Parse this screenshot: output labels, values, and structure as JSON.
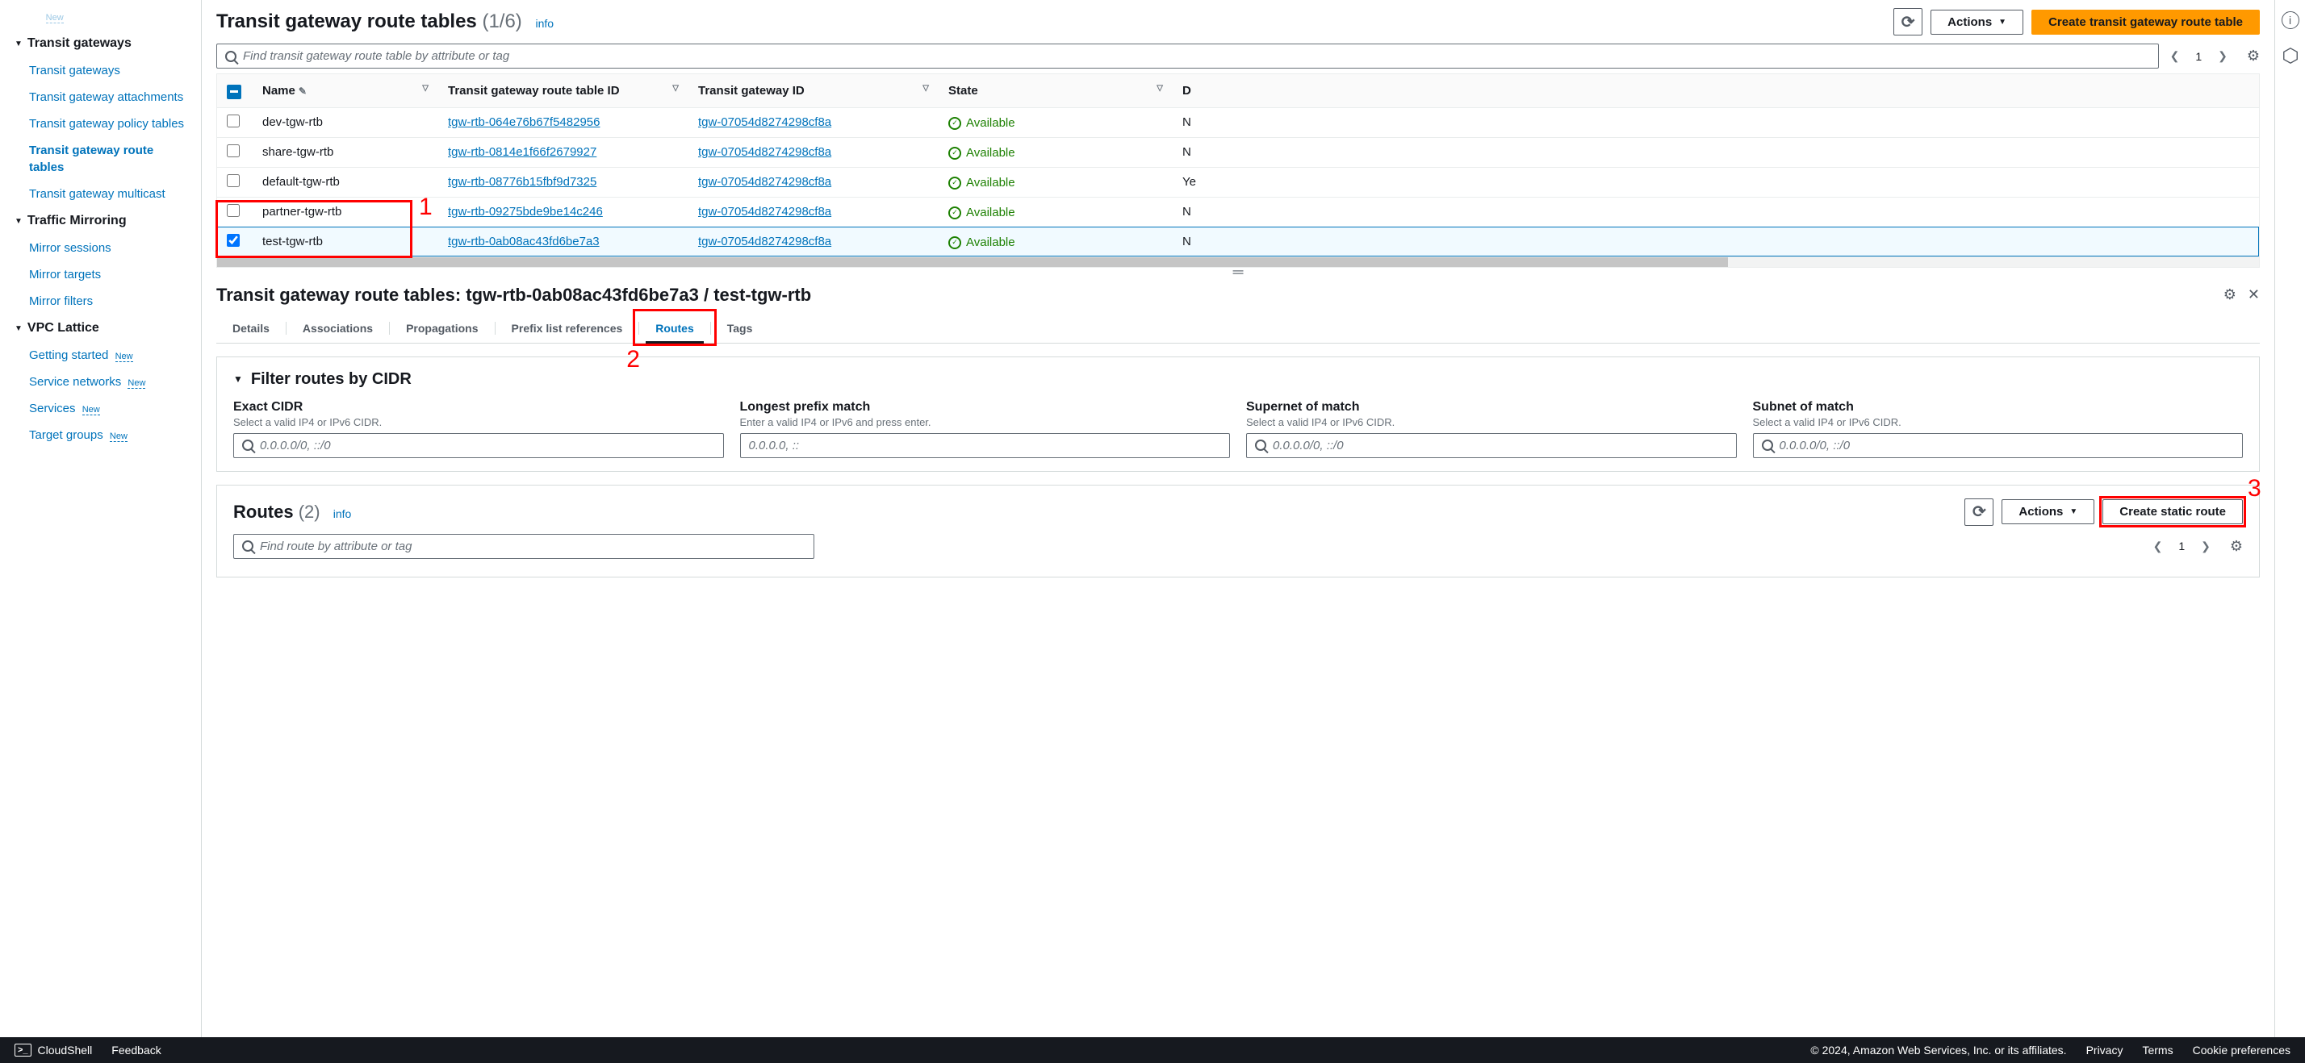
{
  "sidebar": {
    "truncated_top": {
      "label": "",
      "new": "New"
    },
    "sections": [
      {
        "title": "Transit gateways",
        "items": [
          {
            "label": "Transit gateways"
          },
          {
            "label": "Transit gateway attachments"
          },
          {
            "label": "Transit gateway policy tables"
          },
          {
            "label": "Transit gateway route tables",
            "active": true
          },
          {
            "label": "Transit gateway multicast"
          }
        ]
      },
      {
        "title": "Traffic Mirroring",
        "items": [
          {
            "label": "Mirror sessions"
          },
          {
            "label": "Mirror targets"
          },
          {
            "label": "Mirror filters"
          }
        ]
      },
      {
        "title": "VPC Lattice",
        "items": [
          {
            "label": "Getting started",
            "new": "New"
          },
          {
            "label": "Service networks",
            "new": "New"
          },
          {
            "label": "Services",
            "new": "New"
          },
          {
            "label": "Target groups",
            "new": "New"
          }
        ]
      }
    ]
  },
  "header": {
    "title": "Transit gateway route tables",
    "count": "(1/6)",
    "info": "info",
    "actions_label": "Actions",
    "create_label": "Create transit gateway route table",
    "search_placeholder": "Find transit gateway route table by attribute or tag",
    "page": "1"
  },
  "table": {
    "cols": {
      "name": "Name",
      "rtid": "Transit gateway route table ID",
      "tgwid": "Transit gateway ID",
      "state": "State",
      "d": "D"
    },
    "rows": [
      {
        "name": "dev-tgw-rtb",
        "rtid": "tgw-rtb-064e76b67f5482956",
        "tgwid": "tgw-07054d8274298cf8a",
        "state": "Available",
        "d": "N",
        "checked": false
      },
      {
        "name": "share-tgw-rtb",
        "rtid": "tgw-rtb-0814e1f66f2679927",
        "tgwid": "tgw-07054d8274298cf8a",
        "state": "Available",
        "d": "N",
        "checked": false
      },
      {
        "name": "default-tgw-rtb",
        "rtid": "tgw-rtb-08776b15fbf9d7325",
        "tgwid": "tgw-07054d8274298cf8a",
        "state": "Available",
        "d": "Ye",
        "checked": false
      },
      {
        "name": "partner-tgw-rtb",
        "rtid": "tgw-rtb-09275bde9be14c246",
        "tgwid": "tgw-07054d8274298cf8a",
        "state": "Available",
        "d": "N",
        "checked": false
      },
      {
        "name": "test-tgw-rtb",
        "rtid": "tgw-rtb-0ab08ac43fd6be7a3",
        "tgwid": "tgw-07054d8274298cf8a",
        "state": "Available",
        "d": "N",
        "checked": true
      }
    ]
  },
  "detail": {
    "title": "Transit gateway route tables: tgw-rtb-0ab08ac43fd6be7a3 / test-tgw-rtb",
    "tabs": {
      "details": "Details",
      "associations": "Associations",
      "propagations": "Propagations",
      "prefix": "Prefix list references",
      "routes": "Routes",
      "tags": "Tags"
    },
    "filter_title": "Filter routes by CIDR",
    "filters": {
      "exact": {
        "label": "Exact CIDR",
        "hint": "Select a valid IP4 or IPv6 CIDR.",
        "ph": "0.0.0.0/0, ::/0"
      },
      "longest": {
        "label": "Longest prefix match",
        "hint": "Enter a valid IP4 or IPv6 and press enter.",
        "ph": "0.0.0.0, ::"
      },
      "supernet": {
        "label": "Supernet of match",
        "hint": "Select a valid IP4 or IPv6 CIDR.",
        "ph": "0.0.0.0/0, ::/0"
      },
      "subnet": {
        "label": "Subnet of match",
        "hint": "Select a valid IP4 or IPv6 CIDR.",
        "ph": "0.0.0.0/0, ::/0"
      }
    },
    "routes": {
      "title": "Routes",
      "count": "(2)",
      "info": "info",
      "actions_label": "Actions",
      "create_label": "Create static route",
      "search_placeholder": "Find route by attribute or tag",
      "page": "1"
    }
  },
  "footer": {
    "cloudshell": "CloudShell",
    "feedback": "Feedback",
    "copyright": "© 2024, Amazon Web Services, Inc. or its affiliates.",
    "privacy": "Privacy",
    "terms": "Terms",
    "cookie": "Cookie preferences"
  },
  "annotations": {
    "a1": "1",
    "a2": "2",
    "a3": "3"
  }
}
